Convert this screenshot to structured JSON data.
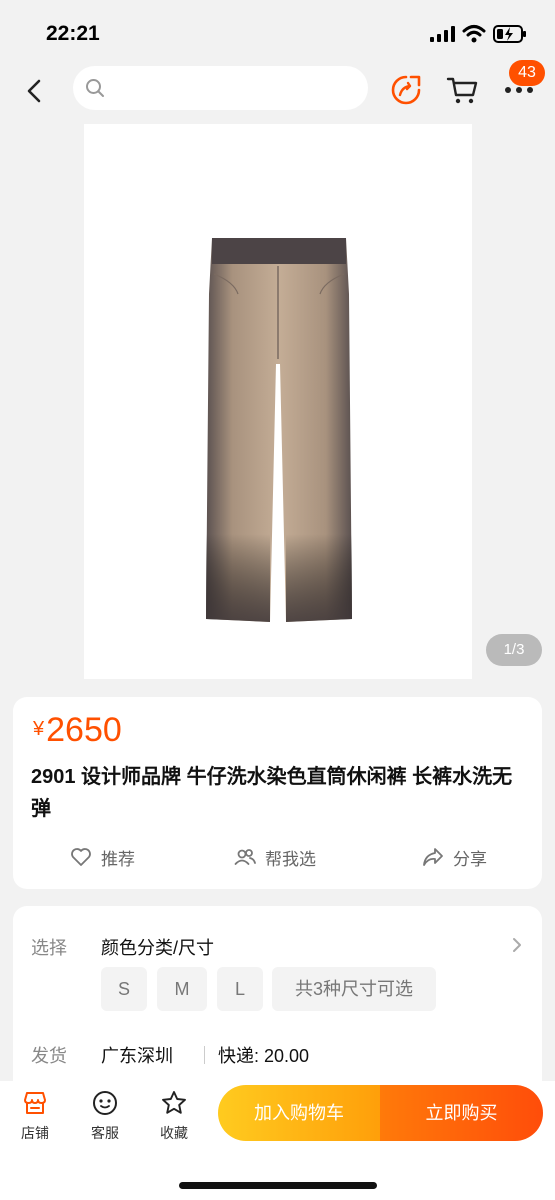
{
  "status_bar": {
    "time": "22:21"
  },
  "nav": {
    "search_placeholder": "",
    "message_badge": "43",
    "accent_color": "#ff5000"
  },
  "gallery": {
    "page_indicator": "1/3"
  },
  "product": {
    "price_symbol": "¥",
    "price": "2650",
    "title": "2901 设计师品牌 牛仔洗水染色直筒休闲裤 长裤水洗无弹",
    "actions": [
      "推荐",
      "帮我选",
      "分享"
    ]
  },
  "options": {
    "select_label": "选择",
    "select_value": "颜色分类/尺寸",
    "sizes": [
      "S",
      "M",
      "L"
    ],
    "sizes_summary": "共3种尺寸可选",
    "ship_label": "发货",
    "ship_origin": "广东深圳",
    "ship_fee": "快递: 20.00"
  },
  "bottom_bar": {
    "tabs": [
      "店铺",
      "客服",
      "收藏"
    ],
    "add_to_cart": "加入购物车",
    "buy_now": "立即购买"
  }
}
